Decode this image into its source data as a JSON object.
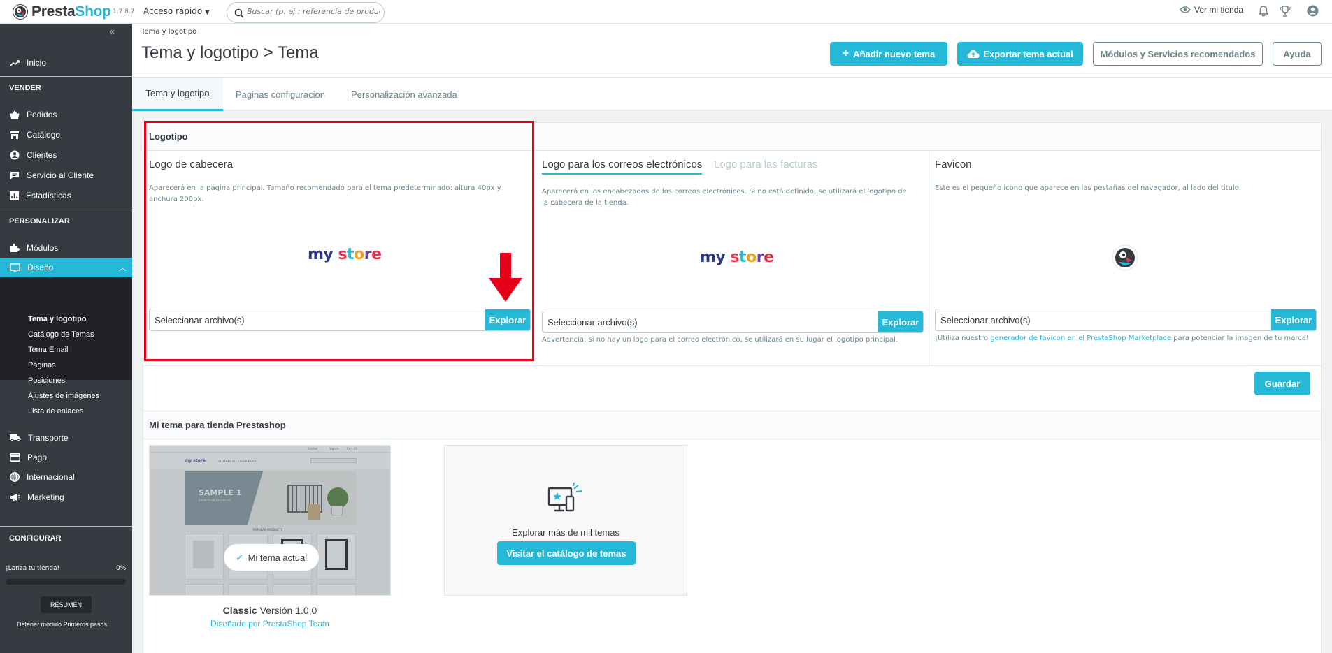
{
  "app": {
    "brand_a": "Presta",
    "brand_b": "Shop",
    "version": "1.7.8.7"
  },
  "topbar": {
    "quick_access": "Acceso rápido",
    "search_placeholder": "Buscar (p. ej.: referencia de producto,",
    "view_store": "Ver mi tienda",
    "icons": [
      "notifications-bell-icon",
      "trophy-icon",
      "account-icon"
    ]
  },
  "sidebar": {
    "home": "Inicio",
    "sell_title": "VENDER",
    "sell": [
      "Pedidos",
      "Catálogo",
      "Clientes",
      "Servicio al Cliente",
      "Estadísticas"
    ],
    "customize_title": "PERSONALIZAR",
    "modules": "Módulos",
    "design": "Diseño",
    "design_sub": [
      "Tema y logotipo",
      "Catálogo de Temas",
      "Tema Email",
      "Páginas",
      "Posiciones",
      "Ajustes de imágenes",
      "Lista de enlaces"
    ],
    "more": [
      "Transporte",
      "Pago",
      "Internacional",
      "Marketing"
    ],
    "configure_title": "CONFIGURAR",
    "launch_label": "¡Lanza tu tienda!",
    "launch_percent": "0%",
    "launch_progress": 0,
    "summary_button": "RESUMEN",
    "stop_module": "Detener módulo Primeros pasos"
  },
  "header": {
    "breadcrumb": "Tema y logotipo",
    "title": "Tema y logotipo > Tema",
    "add_theme": "Añadir nuevo tema",
    "export_theme": "Exportar tema actual",
    "modules_services": "Módulos y Servicios recomendados",
    "help": "Ayuda"
  },
  "tabs": [
    "Tema y logotipo",
    "Paginas configuracion",
    "Personalización avanzada"
  ],
  "logo_card": {
    "title": "Logotipo",
    "header_logo": {
      "title": "Logo de cabecera",
      "help": "Aparecerá en la página principal. Tamaño recomendado para el tema predeterminado: altura 40px y anchura 200px.",
      "logo_text": "my store",
      "file_placeholder": "Seleccionar archivo(s)",
      "browse": "Explorar"
    },
    "email_logo": {
      "tab_active": "Logo para los correos electrónicos",
      "tab_inactive": "Logo para las facturas",
      "help": "Aparecerá en los encabezados de los correos electrónicos. Si no está definido, se utilizará el logotipo de la cabecera de la tienda.",
      "logo_text": "my store",
      "file_placeholder": "Seleccionar archivo(s)",
      "browse": "Explorar",
      "warning": "Advertencia: si no hay un logo para el correo electrónico, se utilizará en su lugar el logotipo principal."
    },
    "favicon": {
      "title": "Favicon",
      "help": "Este es el pequeño icono que aparece en las pestañas del navegador, al lado del titulo.",
      "file_placeholder": "Seleccionar archivo(s)",
      "browse": "Explorar",
      "note_before": "¡Utiliza nuestro ",
      "note_link": "generador de favicon en el PrestaShop Marketplace",
      "note_after": " para potenciar la imagen de tu marca!"
    },
    "save": "Guardar"
  },
  "theme_card": {
    "title": "Mi tema para tienda Prestashop",
    "current_badge": "Mi tema actual",
    "theme_name": "Classic",
    "theme_version": "Versión 1.0.0",
    "designed_by": "Diseñado por PrestaShop Team",
    "preview": {
      "store_logo": "my store",
      "slide_title": "SAMPLE 1",
      "slide_sub": "EXCEPTEUR OCCAECAT",
      "popular": "POPULAR PRODUCTS",
      "nav": "CLOTHES   ACCESSORIES   ART",
      "lang": "English",
      "signin": "Sign in",
      "cart": "Cart (0)"
    },
    "explore_text": "Explorar más de mil temas",
    "explore_button": "Visitar el catálogo de temas"
  },
  "colors": {
    "accent": "#25b9d7",
    "sidebar": "#363a41",
    "highlight": "#e6001a"
  }
}
